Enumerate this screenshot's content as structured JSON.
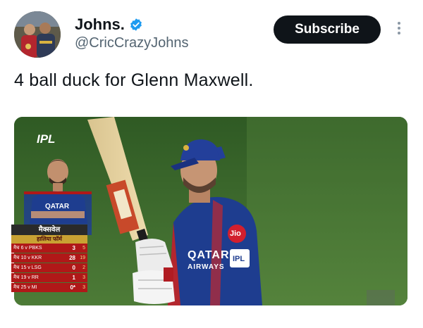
{
  "author": {
    "display_name": "Johns.",
    "handle": "@CricCrazyJohns",
    "verified_icon": "verified-badge-icon",
    "verified_color": "#1d9bf0"
  },
  "actions": {
    "subscribe_label": "Subscribe",
    "more_icon": "more-vertical-icon"
  },
  "tweet": {
    "text": "4 ball duck for Glenn Maxwell."
  },
  "media": {
    "broadcast_logo": "IPL",
    "graphic": {
      "jersey_sponsor": "QATAR",
      "player_name_hindi": "मैक्सवेल",
      "subtitle_hindi": "हालिया फॉर्म",
      "rows": [
        {
          "label": "मैच 6 v PBKS",
          "runs": "3",
          "balls": "5"
        },
        {
          "label": "मैच 10 v KKR",
          "runs": "28",
          "balls": "19"
        },
        {
          "label": "मैच 15 v LSG",
          "runs": "0",
          "balls": "2"
        },
        {
          "label": "मैच 19 v RR",
          "runs": "1",
          "balls": "3"
        },
        {
          "label": "मैच 25 v MI",
          "runs": "0*",
          "balls": "3"
        }
      ]
    },
    "player_jersey": {
      "sponsor_left": "QATAR",
      "sponsor_left_sub": "AIRWAYS",
      "chest_badge": "Jio",
      "sleeve_text": "IPL"
    }
  },
  "colors": {
    "subscribe_bg": "#0f1419",
    "handle_gray": "#536471",
    "pitch_green": "#3f6b2f",
    "rcb_blue": "#1e3d8f",
    "stat_red": "#b01818"
  }
}
